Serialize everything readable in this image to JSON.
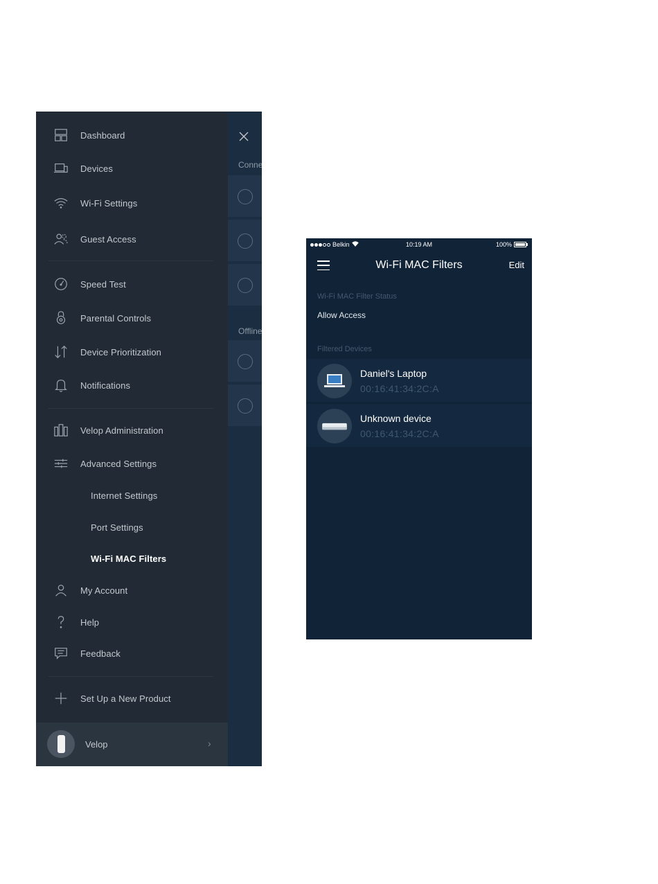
{
  "drawer": {
    "menu": [
      {
        "label": "Dashboard",
        "icon": "dashboard-icon"
      },
      {
        "label": "Devices",
        "icon": "devices-icon"
      },
      {
        "label": "Wi-Fi Settings",
        "icon": "wifi-icon"
      },
      {
        "label": "Guest Access",
        "icon": "guest-access-icon"
      },
      {
        "label": "Speed Test",
        "icon": "speedometer-icon"
      },
      {
        "label": "Parental Controls",
        "icon": "lock-icon"
      },
      {
        "label": "Device Prioritization",
        "icon": "up-down-arrows-icon"
      },
      {
        "label": "Notifications",
        "icon": "bell-icon"
      },
      {
        "label": "Velop Administration",
        "icon": "velop-nodes-icon"
      },
      {
        "label": "Advanced Settings",
        "icon": "sliders-icon"
      },
      {
        "label": "Internet Settings"
      },
      {
        "label": "Port Settings"
      },
      {
        "label": "Wi-Fi MAC Filters"
      },
      {
        "label": "My Account",
        "icon": "person-icon"
      },
      {
        "label": "Help",
        "icon": "question-icon"
      },
      {
        "label": "Feedback",
        "icon": "chat-icon"
      },
      {
        "label": "Set Up a New Product",
        "icon": "plus-icon"
      }
    ],
    "active_item": "Wi-Fi MAC Filters",
    "footer": {
      "label": "Velop"
    },
    "background_peek": {
      "connected_label": "Conne",
      "offline_label": "Offline"
    }
  },
  "phone": {
    "status_bar": {
      "carrier": "Belkin",
      "time": "10:19 AM",
      "battery": "100%"
    },
    "nav": {
      "title": "Wi-Fi MAC Filters",
      "edit_label": "Edit"
    },
    "filter_status_label": "Wi-Fi MAC Filter Status",
    "filter_status_value": "Allow Access",
    "filtered_devices_label": "Filtered Devices",
    "devices": [
      {
        "name": "Daniel's Laptop",
        "mac": "00:16:41:34:2C:A",
        "icon": "laptop-icon"
      },
      {
        "name": "Unknown device",
        "mac": "00:16:41:34:2C:A",
        "icon": "generic-device-icon"
      }
    ]
  },
  "colors": {
    "drawer_bg": "#222b35",
    "phone_bg": "#102337",
    "row_bg": "#14293f",
    "muted_text": "#3f5770"
  }
}
